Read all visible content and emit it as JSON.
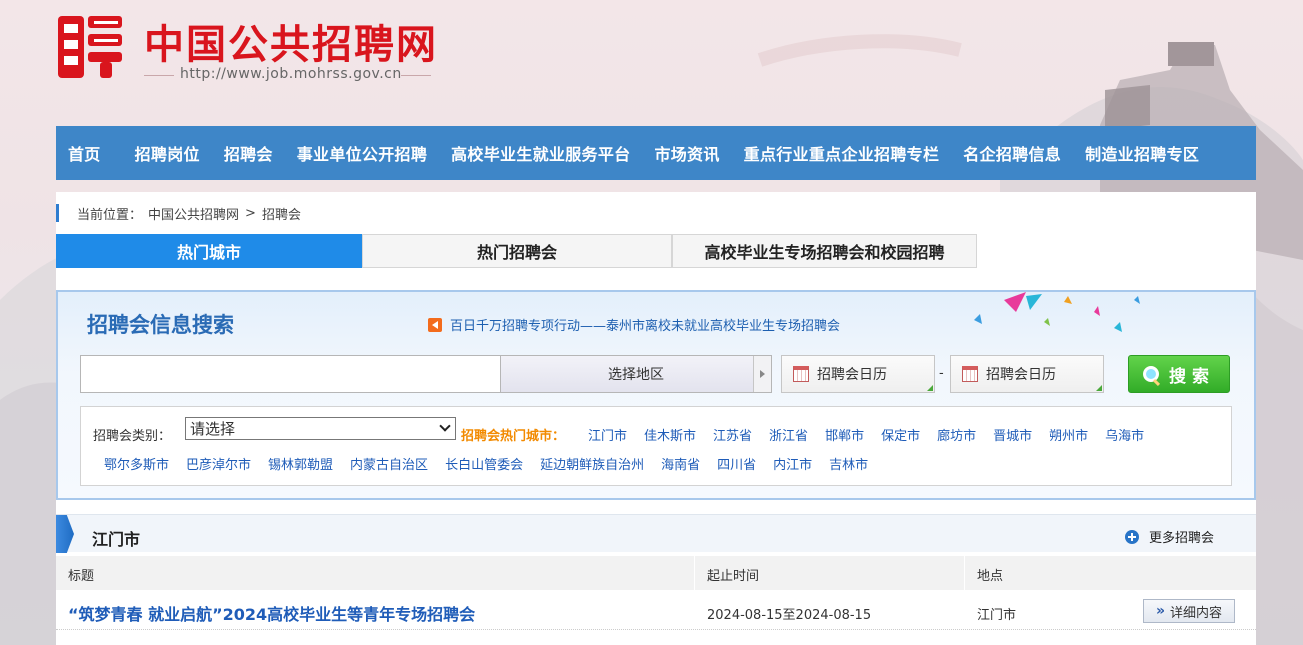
{
  "header": {
    "site_title": "中国公共招聘网",
    "site_url": "http://www.job.mohrss.gov.cn",
    "logo_icon": "pin-logo-icon"
  },
  "nav": [
    {
      "label": "首页"
    },
    {
      "label": "招聘岗位"
    },
    {
      "label": "招聘会"
    },
    {
      "label": "事业单位公开招聘"
    },
    {
      "label": "高校毕业生就业服务平台"
    },
    {
      "label": "市场资讯"
    },
    {
      "label": "重点行业重点企业招聘专栏"
    },
    {
      "label": "名企招聘信息"
    },
    {
      "label": "制造业招聘专区"
    }
  ],
  "breadcrumb": {
    "prefix": "当前位置：",
    "items": [
      "中国公共招聘网",
      "招聘会"
    ],
    "separator": ">"
  },
  "tabs": [
    {
      "label": "热门城市",
      "active": true
    },
    {
      "label": "热门招聘会",
      "active": false
    },
    {
      "label": "高校毕业生专场招聘会和校园招聘",
      "active": false
    }
  ],
  "search": {
    "title": "招聘会信息搜索",
    "notice": "百日千万招聘专项行动——泰州市离校未就业高校毕业生专场招聘会",
    "keyword_value": "",
    "region_label": "选择地区",
    "date_start_label": "招聘会日历",
    "date_dash": "-",
    "date_end_label": "招聘会日历",
    "button_label": "搜索",
    "category_label": "招聘会类别：",
    "category_value": "请选择",
    "hot_cities_label": "招聘会热门城市：",
    "hot_cities_row1": [
      "江门市",
      "佳木斯市",
      "江苏省",
      "浙江省",
      "邯郸市",
      "保定市",
      "廊坊市",
      "晋城市",
      "朔州市",
      "乌海市"
    ],
    "hot_cities_row2": [
      "鄂尔多斯市",
      "巴彦淖尔市",
      "锡林郭勒盟",
      "内蒙古自治区",
      "长白山管委会",
      "延边朝鲜族自治州",
      "海南省",
      "四川省",
      "内江市",
      "吉林市"
    ]
  },
  "results": {
    "section_title": "江门市",
    "more_label": "更多招聘会",
    "columns": [
      "标题",
      "起止时间",
      "地点"
    ],
    "rows": [
      {
        "title": "“筑梦青春 就业启航”2024高校毕业生等青年专场招聘会",
        "dates": "2024-08-15至2024-08-15",
        "location": "江门市",
        "detail_label": "详细内容"
      }
    ]
  },
  "colors": {
    "nav_bg": "#3e86c8",
    "title_red": "#d9151d",
    "active_tab": "#1f8be8",
    "link_blue": "#1f5cb8",
    "hot_orange": "#f28a00",
    "search_green": "#32ac28"
  }
}
